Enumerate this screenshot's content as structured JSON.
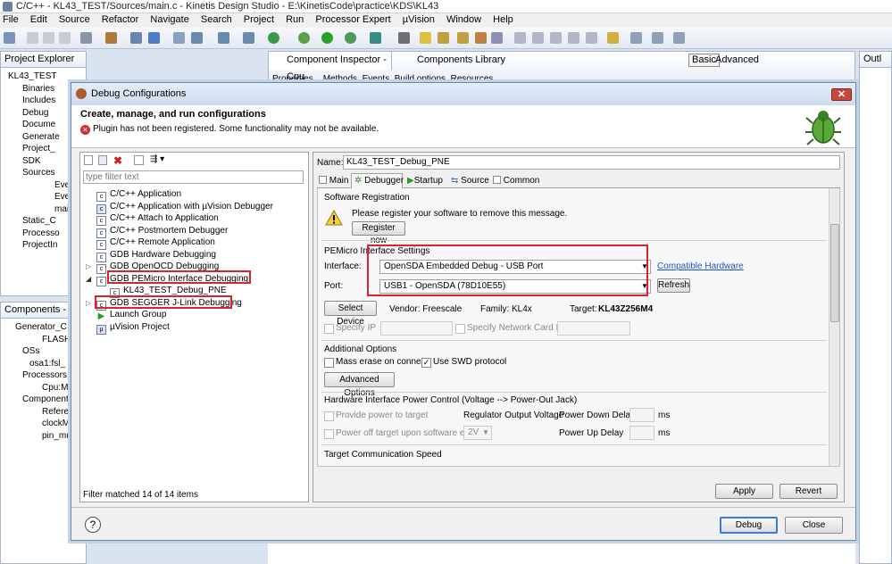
{
  "window": {
    "title": "C/C++ - KL43_TEST/Sources/main.c - Kinetis Design Studio - E:\\KinetisCode\\practice\\KDS\\KL43"
  },
  "menu": [
    "File",
    "Edit",
    "Source",
    "Refactor",
    "Navigate",
    "Search",
    "Project",
    "Run",
    "Processor Expert",
    "µVision",
    "Window",
    "Help"
  ],
  "project_explorer": {
    "tab": "Project Explorer",
    "items": [
      "KL43_TEST",
      "Binaries",
      "Includes",
      "Debug",
      "Docume",
      "Generate",
      "Project_",
      "SDK",
      "Sources",
      "Even",
      "Even",
      "mair",
      "Static_C",
      "Processo",
      "ProjectIn"
    ]
  },
  "components_view": {
    "tab": "Components - K",
    "items": [
      "Generator_C",
      "FLASH",
      "OSs",
      "osa1:fsl_",
      "Processors",
      "Cpu:MK",
      "Component",
      "Referenc",
      "clockMa",
      "pin_mux"
    ]
  },
  "editor_tabs": {
    "inspector": "Component Inspector - Cpu",
    "library": "Components Library",
    "basic": "Basic",
    "advanced": "Advanced",
    "outline": "Outl"
  },
  "inspector_subtabs": [
    "Properties",
    "Methods",
    "Events",
    "Build options",
    "Resources"
  ],
  "dialog": {
    "title": "Debug Configurations",
    "header": "Create, manage, and run configurations",
    "warning": "Plugin has not been registered. Some functionality may not be available.",
    "filter_placeholder": "type filter text",
    "config_types": [
      "C/C++ Application",
      "C/C++ Application with µVision Debugger",
      "C/C++ Attach to Application",
      "C/C++ Postmortem Debugger",
      "C/C++ Remote Application",
      "GDB Hardware Debugging",
      "GDB OpenOCD Debugging",
      "GDB PEMicro Interface Debugging",
      "KL43_TEST_Debug_PNE",
      "GDB SEGGER J-Link Debugging",
      "Launch Group",
      "µVision Project"
    ],
    "filter_status": "Filter matched 14 of 14 items",
    "name_label": "Name:",
    "name_value": "KL43_TEST_Debug_PNE",
    "tabs": [
      "Main",
      "Debugger",
      "Startup",
      "Source",
      "Common"
    ],
    "software_registration": {
      "title": "Software Registration",
      "message": "Please register your software to remove this message.",
      "button": "Register now"
    },
    "pemicro": {
      "title": "PEMicro Interface Settings",
      "interface_label": "Interface:",
      "interface_value": "OpenSDA Embedded Debug - USB Port",
      "compat_link": "Compatible Hardware",
      "port_label": "Port:",
      "port_value": "USB1 - OpenSDA (78D10E55)",
      "refresh": "Refresh",
      "select_device": "Select Device",
      "vendor": "Vendor: Freescale",
      "family": "Family: KL4x",
      "target_label": "Target:",
      "target_value": "KL43Z256M4",
      "specify_ip": "Specify IP",
      "specify_nic": "Specify Network Card IP"
    },
    "additional": {
      "title": "Additional Options",
      "mass_erase": "Mass erase on connect",
      "swd": "Use SWD protocol",
      "swd_checked": true,
      "button": "Advanced Options"
    },
    "power": {
      "title": "Hardware Interface Power Control (Voltage --> Power-Out Jack)",
      "provide": "Provide power to target",
      "regulator": "Regulator Output Voltage",
      "down_delay": "Power Down Delay",
      "ms1": "ms",
      "power_off": "Power off target upon software exit",
      "voltage": "2V",
      "up_delay": "Power Up Delay",
      "ms2": "ms"
    },
    "target_comm": "Target Communication Speed",
    "apply": "Apply",
    "revert": "Revert",
    "debug": "Debug",
    "close": "Close",
    "help": "?"
  }
}
